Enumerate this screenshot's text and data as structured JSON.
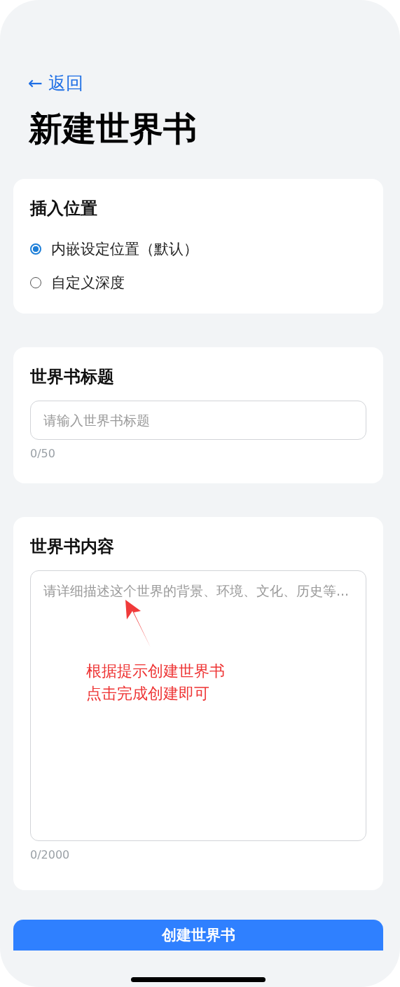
{
  "back_link": {
    "label": "← 返回"
  },
  "title": "新建世界书",
  "insert_position": {
    "heading": "插入位置",
    "options": [
      {
        "label": "内嵌设定位置（默认）",
        "selected": true
      },
      {
        "label": "自定义深度",
        "selected": false
      }
    ]
  },
  "title_field": {
    "heading": "世界书标题",
    "placeholder": "请输入世界书标题",
    "counter": "0/50"
  },
  "content_field": {
    "heading": "世界书内容",
    "placeholder": "请详细描述这个世界的背景、环境、文化、历史等...",
    "counter": "0/2000"
  },
  "annotation": {
    "lines": [
      "根据提示创建世界书",
      "点击完成创建即可"
    ]
  },
  "submit_button": {
    "label": "创建世界书"
  }
}
